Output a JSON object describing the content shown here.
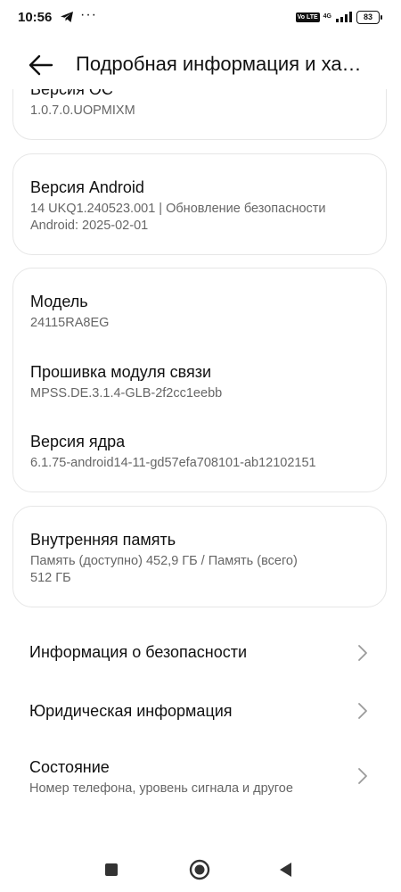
{
  "status_bar": {
    "time": "10:56",
    "dots": "···",
    "network": "4G",
    "volte": "Vo LTE",
    "battery": "83"
  },
  "header": {
    "title": "Подробная информация и ха…",
    "back_icon": "arrow-back-icon"
  },
  "cards": {
    "os": {
      "label": "Версия ОС",
      "value": "1.0.7.0.UOPMIXM"
    },
    "android": {
      "label": "Версия Android",
      "value_line1": "14 UKQ1.240523.001 | Обновление безопасности",
      "value_line2": "Android: 2025-02-01"
    },
    "device": {
      "model_label": "Модель",
      "model_value": "24115RA8EG",
      "baseband_label": "Прошивка модуля связи",
      "baseband_value": "MPSS.DE.3.1.4-GLB-2f2cc1eebb",
      "kernel_label": "Версия ядра",
      "kernel_value": "6.1.75-android14-11-gd57efa708101-ab12102151"
    },
    "storage": {
      "label": "Внутренняя память",
      "value_line1": "Память (доступно)  452,9 ГБ / Память (всего)",
      "value_line2": "512 ГБ"
    }
  },
  "menu": [
    {
      "label": "Информация о безопасности",
      "sub": ""
    },
    {
      "label": "Юридическая информация",
      "sub": ""
    },
    {
      "label": "Состояние",
      "sub": "Номер телефона, уровень сигнала и другое"
    }
  ],
  "nav": {
    "recents_icon": "square-recents-icon",
    "home_icon": "circle-home-icon",
    "back_icon": "triangle-back-icon"
  }
}
